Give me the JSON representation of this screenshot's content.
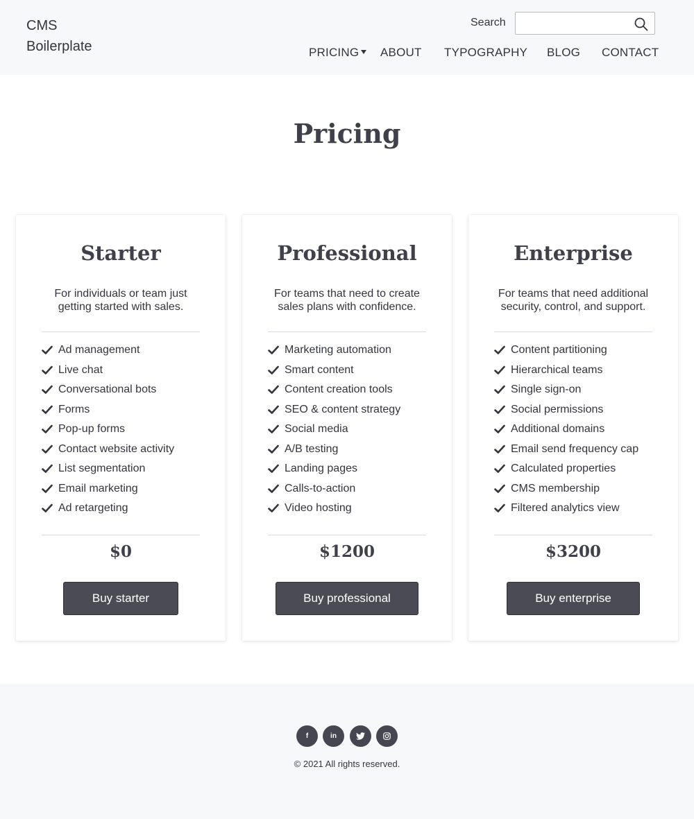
{
  "header": {
    "logo": "CMS Boilerplate",
    "search_label": "Search",
    "search_placeholder": "",
    "nav": [
      {
        "label": "PRICING"
      },
      {
        "label": "ABOUT"
      },
      {
        "label": "TYPOGRAPHY"
      },
      {
        "label": "BLOG"
      },
      {
        "label": "CONTACT"
      }
    ]
  },
  "page": {
    "title": "Pricing"
  },
  "plans": [
    {
      "name": "Starter",
      "description": "For individuals or team just getting started with sales.",
      "features": [
        "Ad management",
        "Live chat",
        "Conversational bots",
        "Forms",
        "Pop-up forms",
        "Contact website activity",
        "List segmentation",
        "Email marketing",
        "Ad retargeting"
      ],
      "price": "$0",
      "button": "Buy starter"
    },
    {
      "name": "Professional",
      "description": "For teams that need to create sales plans with confidence.",
      "features": [
        "Marketing automation",
        "Smart content",
        "Content creation tools",
        "SEO & content strategy",
        "Social media",
        "A/B testing",
        "Landing pages",
        "Calls-to-action",
        "Video hosting"
      ],
      "price": "$1200",
      "button": "Buy professional"
    },
    {
      "name": "Enterprise",
      "description": "For teams that need additional security, control, and support.",
      "features": [
        "Content partitioning",
        "Hierarchical teams",
        "Single sign-on",
        "Social permissions",
        "Additional domains",
        "Email send frequency cap",
        "Calculated properties",
        "CMS membership",
        "Filtered analytics view"
      ],
      "price": "$3200",
      "button": "Buy enterprise"
    }
  ],
  "footer": {
    "social": [
      {
        "icon": "facebook-icon",
        "glyph": "f"
      },
      {
        "icon": "linkedin-icon",
        "glyph": "in"
      },
      {
        "icon": "twitter-icon",
        "glyph": ""
      },
      {
        "icon": "instagram-icon",
        "glyph": ""
      }
    ],
    "copyright": "© 2021 All rights reserved."
  },
  "colors": {
    "header_bg": "#f7f8fa",
    "text": "#33343d",
    "button_bg": "#4a4b55"
  }
}
